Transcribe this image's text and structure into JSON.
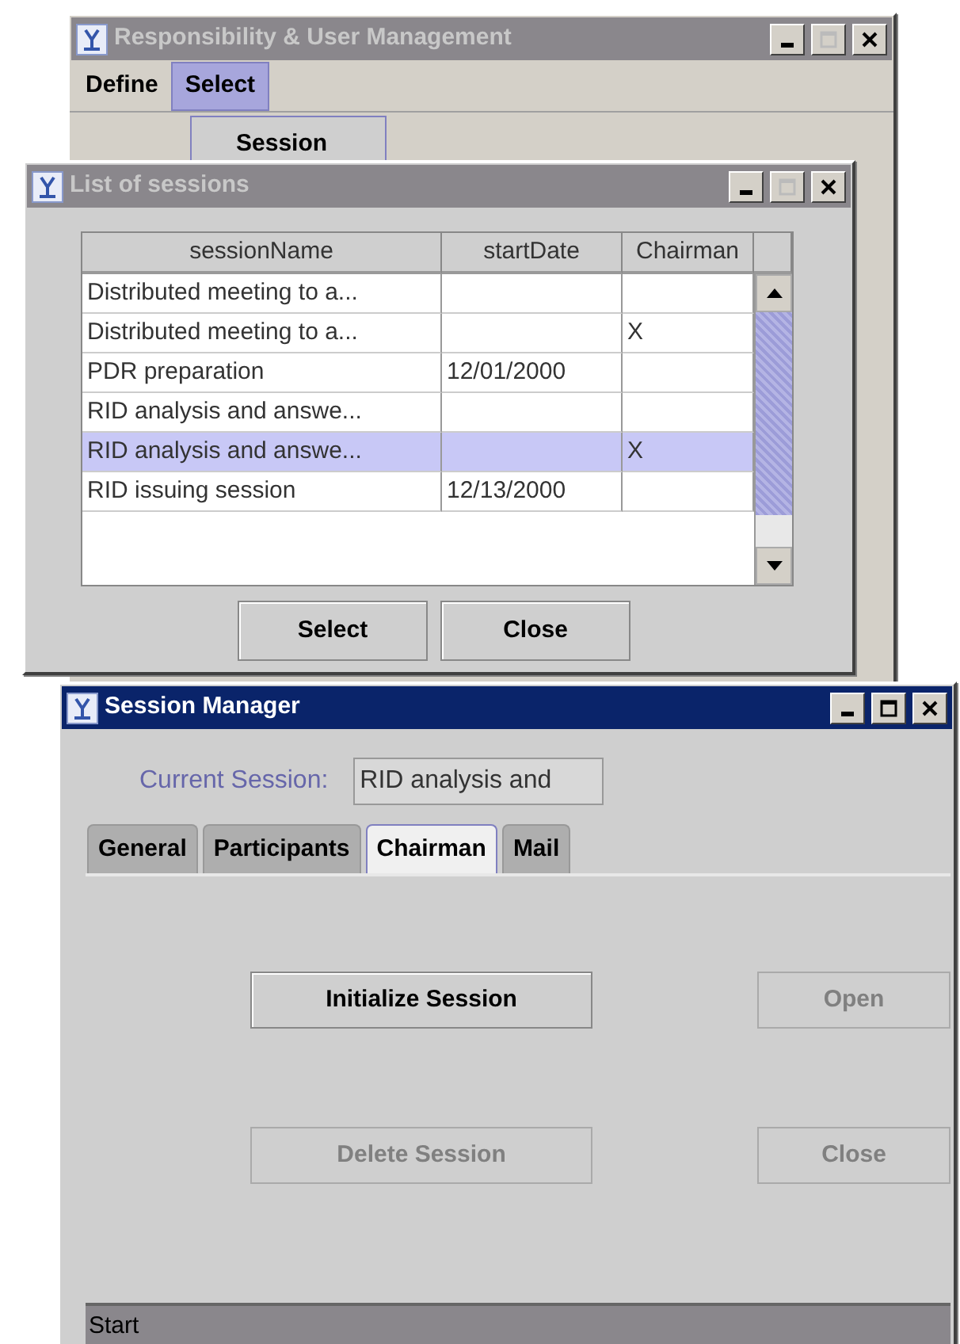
{
  "windows": [
    {
      "kind": "main",
      "title": "Responsibility & User Management",
      "active": false,
      "menu": [
        {
          "label": "Define",
          "selected": false
        },
        {
          "label": "Select",
          "selected": true
        }
      ],
      "dropdown": [
        "Session"
      ]
    },
    {
      "kind": "list",
      "title": "List of sessions",
      "active": false,
      "table": {
        "columns": [
          "sessionName",
          "startDate",
          "Chairman"
        ],
        "rows": [
          {
            "cells": [
              "Distributed meeting to a...",
              "",
              ""
            ],
            "selected": false
          },
          {
            "cells": [
              "Distributed meeting to a...",
              "",
              "X"
            ],
            "selected": false
          },
          {
            "cells": [
              "PDR preparation",
              "12/01/2000",
              ""
            ],
            "selected": false
          },
          {
            "cells": [
              "RID analysis and answe...",
              "",
              ""
            ],
            "selected": false
          },
          {
            "cells": [
              "RID analysis and answe...",
              "",
              "X"
            ],
            "selected": true
          },
          {
            "cells": [
              "RID issuing session",
              "12/13/2000",
              ""
            ],
            "selected": false
          }
        ]
      },
      "buttons": [
        "Select",
        "Close"
      ]
    },
    {
      "kind": "manager",
      "title": "Session Manager",
      "active": true,
      "current_session": {
        "label": "Current Session:",
        "value": "RID analysis and"
      },
      "tabs": [
        {
          "label": "General",
          "selected": false
        },
        {
          "label": "Participants",
          "selected": false
        },
        {
          "label": "Chairman",
          "selected": true
        },
        {
          "label": "Mail",
          "selected": false
        }
      ],
      "buttons": [
        {
          "label": "Initialize Session",
          "disabled": false
        },
        {
          "label": "Open",
          "disabled": true
        },
        {
          "label": "Delete Session",
          "disabled": true
        },
        {
          "label": "Close",
          "disabled": true
        }
      ],
      "status_bar": "Start"
    }
  ]
}
